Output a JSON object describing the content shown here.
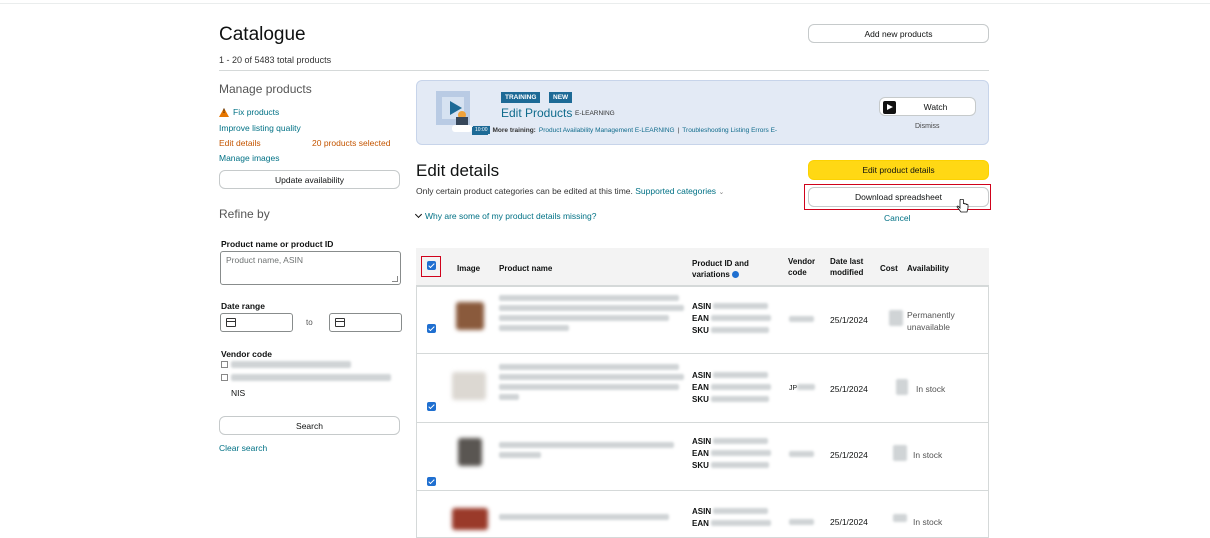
{
  "header": {
    "title": "Catalogue",
    "total": "1 - 20 of 5483 total products",
    "add_button": "Add new products"
  },
  "manage": {
    "heading": "Manage products",
    "fix": "Fix products",
    "improve": "Improve listing quality",
    "edit_details": "Edit details",
    "selected": "20 products selected",
    "manage_images": "Manage images",
    "update_button": "Update availability"
  },
  "refine": {
    "heading": "Refine by",
    "product_label": "Product name or product ID",
    "product_placeholder": "Product name, ASIN",
    "date_label": "Date range",
    "date_to": "to",
    "vendor_label": "Vendor code",
    "vendor_suffix": "NIS",
    "search_button": "Search",
    "clear": "Clear search"
  },
  "banner": {
    "tag1": "TRAINING",
    "tag2": "NEW",
    "title": "Edit Products",
    "subtitle": "E-LEARNING",
    "time": "10:00",
    "more_label": "More training:",
    "more_link1": "Product Availability Management E-LEARNING",
    "separator": "|",
    "more_link2": "Troubleshooting Listing Errors E-",
    "watch": "Watch",
    "dismiss": "Dismiss"
  },
  "edit": {
    "title": "Edit details",
    "desc": "Only certain product categories can be edited at this time.",
    "supported": "Supported categories",
    "why": "Why are some of my product details missing?",
    "edit_button": "Edit product details",
    "download_button": "Download spreadsheet",
    "cancel": "Cancel"
  },
  "table": {
    "headers": {
      "image": "Image",
      "name": "Product name",
      "pid1": "Product ID and",
      "pid2": "variations",
      "vendor1": "Vendor",
      "vendor2": "code",
      "date1": "Date last",
      "date2": "modified",
      "cost": "Cost",
      "availability": "Availability"
    },
    "id_labels": {
      "asin": "ASIN",
      "ean": "EAN",
      "sku": "SKU"
    },
    "rows": [
      {
        "date": "25/1/2024",
        "availability": "Permanently",
        "availability2": "unavailable",
        "vendor_prefix": ""
      },
      {
        "date": "25/1/2024",
        "availability": "In stock",
        "availability2": "",
        "vendor_prefix": "JP"
      },
      {
        "date": "25/1/2024",
        "availability": "In stock",
        "availability2": "",
        "vendor_prefix": ""
      },
      {
        "date": "25/1/2024",
        "availability": "In stock",
        "availability2": "",
        "vendor_prefix": ""
      }
    ]
  },
  "colors": {
    "link": "#007185",
    "accent_orange": "#c45500",
    "primary_button": "#ffd814",
    "highlight_red": "#d0021b",
    "checkbox_blue": "#1f6fd0"
  }
}
